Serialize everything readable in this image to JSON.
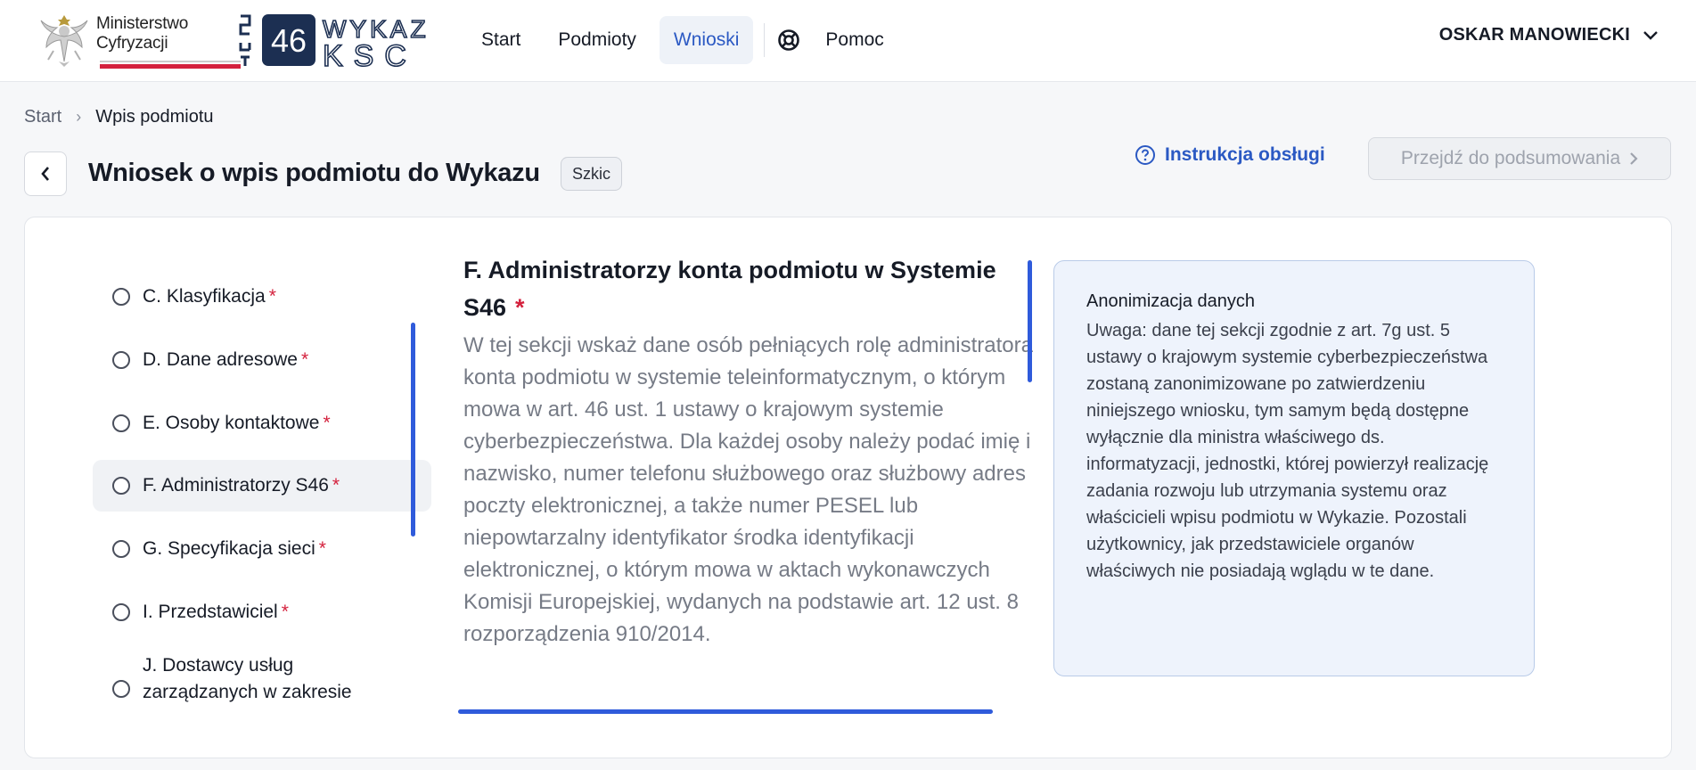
{
  "header": {
    "ministry_line1": "Ministerstwo",
    "ministry_line2": "Cyfryzacji",
    "logo_s46": "46",
    "logo_wykaz": "WYKAZ",
    "logo_ksc": "KSC",
    "nav": {
      "start": "Start",
      "podmioty": "Podmioty",
      "wnioski": "Wnioski",
      "pomoc": "Pomoc"
    },
    "user_name": "OSKAR MANOWIECKI"
  },
  "breadcrumb": {
    "start": "Start",
    "separator": "›",
    "current": "Wpis podmiotu"
  },
  "page": {
    "title": "Wniosek o wpis podmiotu do Wykazu",
    "status_badge": "Szkic",
    "instruction_link": "Instrukcja obsługi",
    "summary_button": "Przejdź do podsumowania"
  },
  "steps": [
    {
      "label": "C. Klasyfikacja",
      "required": "*"
    },
    {
      "label": "D. Dane adresowe",
      "required": "*"
    },
    {
      "label": "E. Osoby kontaktowe",
      "required": "*"
    },
    {
      "label": "F. Administratorzy S46",
      "required": "*"
    },
    {
      "label": "G. Specyfikacja sieci",
      "required": "*"
    },
    {
      "label": "I. Przedstawiciel",
      "required": "*"
    },
    {
      "label_line1": "J. Dostawcy usług",
      "label_line2": "zarządzanych w zakresie"
    }
  ],
  "section": {
    "title": "F. Administratorzy konta podmiotu w Systemie S46",
    "required": "*",
    "description": "W tej sekcji wskaż dane osób pełniących rolę administratora konta podmiotu w systemie teleinformatycznym, o którym mowa w art. 46 ust. 1 ustawy o krajowym systemie cyberbezpieczeństwa. Dla każdej osoby należy podać imię i nazwisko, numer telefonu służbowego oraz służbowy adres poczty elektronicznej, a także numer PESEL lub niepowtarzalny identyfikator środka identyfikacji elektronicznej, o którym mowa w aktach wykonawczych Komisji Europejskiej, wydanych na podstawie art. 12 ust. 8 rozporządzenia 910/2014."
  },
  "info_box": {
    "title": "Anonimizacja danych",
    "text": "Uwaga: dane tej sekcji zgodnie z art. 7g ust. 5 ustawy o krajowym systemie cyberbezpieczeństwa zostaną zanonimizowane po zatwierdzeniu niniejszego wniosku, tym samym będą dostępne wyłącznie dla ministra właściwego ds. informatyzacji, jednostki, której powierzył realizację zadania rozwoju lub utrzymania systemu oraz właścicieli wpisu podmiotu w Wykazie. Pozostali użytkownicy, jak przedstawiciele organów właściwych nie posiadają wglądu w te dane."
  },
  "colors": {
    "accent": "#2b59c3",
    "scrollbar": "#2f5bdb",
    "required": "#d4213d",
    "ministry_red": "#d4213d",
    "logo_navy": "#1c2f52"
  },
  "icons": {
    "eagle": "eagle-emblem-icon",
    "help": "lifebuoy-icon",
    "user_menu": "chevron-down-icon",
    "back": "chevron-left-icon",
    "instruction": "question-circle-icon",
    "summary": "chevron-right-icon",
    "step": "radio-circle-icon"
  }
}
